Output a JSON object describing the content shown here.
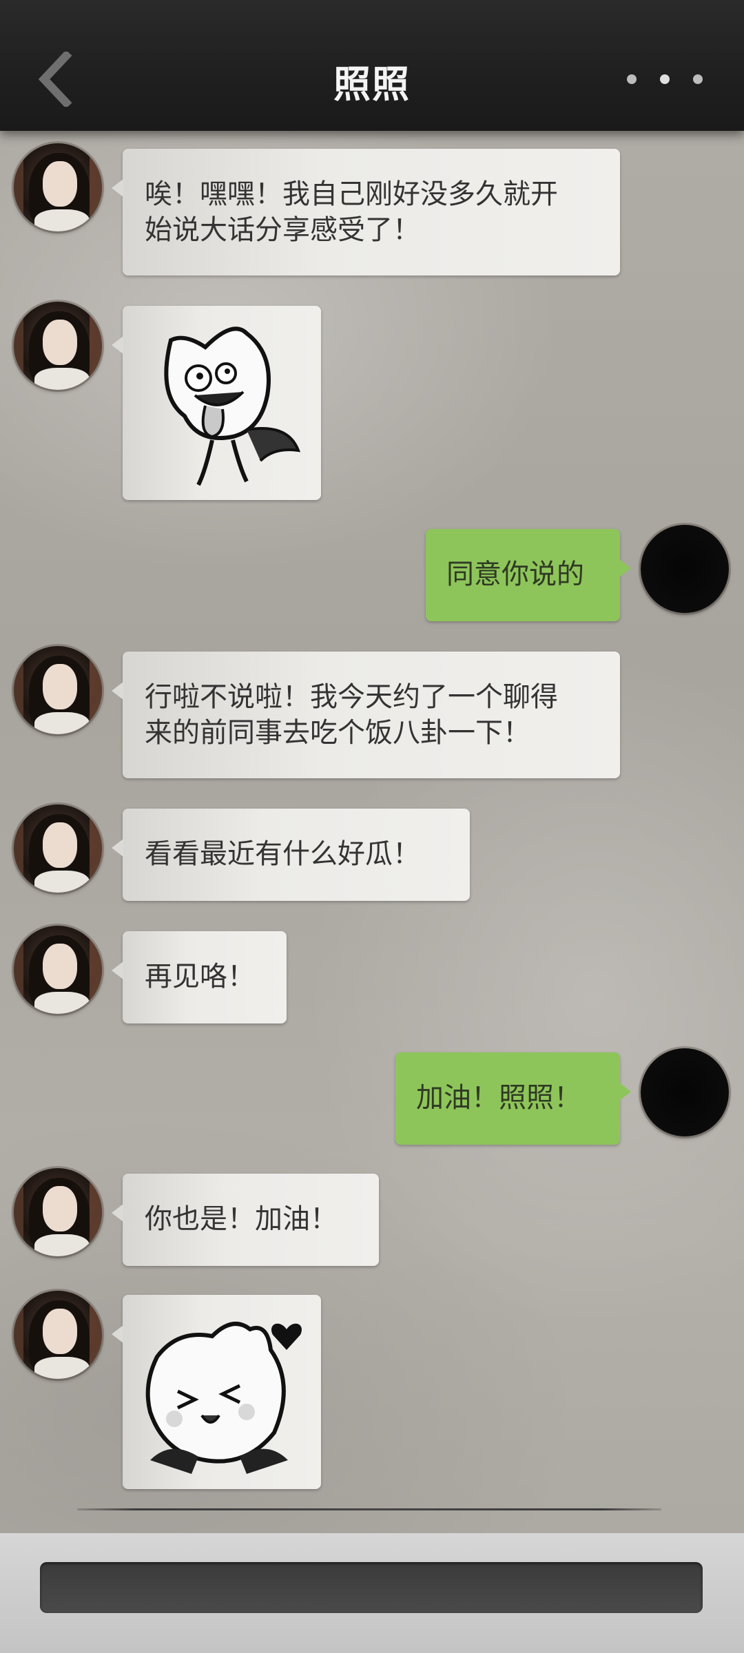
{
  "header": {
    "title": "照照",
    "back_icon": "chevron-left-icon",
    "more_icon": "more-dots-icon"
  },
  "messages": [
    {
      "side": "left",
      "type": "text",
      "lines": [
        "唉！嘿嘿！我自己刚好没多久就开",
        "始说大话分享感受了！"
      ]
    },
    {
      "side": "left",
      "type": "sticker",
      "sticker": "cat-tongue-sticker"
    },
    {
      "side": "right",
      "type": "text",
      "lines": [
        "同意你说的"
      ]
    },
    {
      "side": "left",
      "type": "text",
      "lines": [
        "行啦不说啦！我今天约了一个聊得",
        "来的前同事去吃个饭八卦一下！"
      ]
    },
    {
      "side": "left",
      "type": "text",
      "lines": [
        "看看最近有什么好瓜！"
      ]
    },
    {
      "side": "left",
      "type": "text",
      "lines": [
        "再见咯！"
      ]
    },
    {
      "side": "right",
      "type": "text",
      "lines": [
        "加油！照照！"
      ]
    },
    {
      "side": "left",
      "type": "text",
      "lines": [
        "你也是！加油！"
      ]
    },
    {
      "side": "left",
      "type": "sticker",
      "sticker": "cat-heart-sticker"
    }
  ],
  "colors": {
    "header_bg": "#1f1f1f",
    "bubble_left": "#ecebe8",
    "bubble_right": "#8ec55a",
    "input_bg": "#454545"
  }
}
